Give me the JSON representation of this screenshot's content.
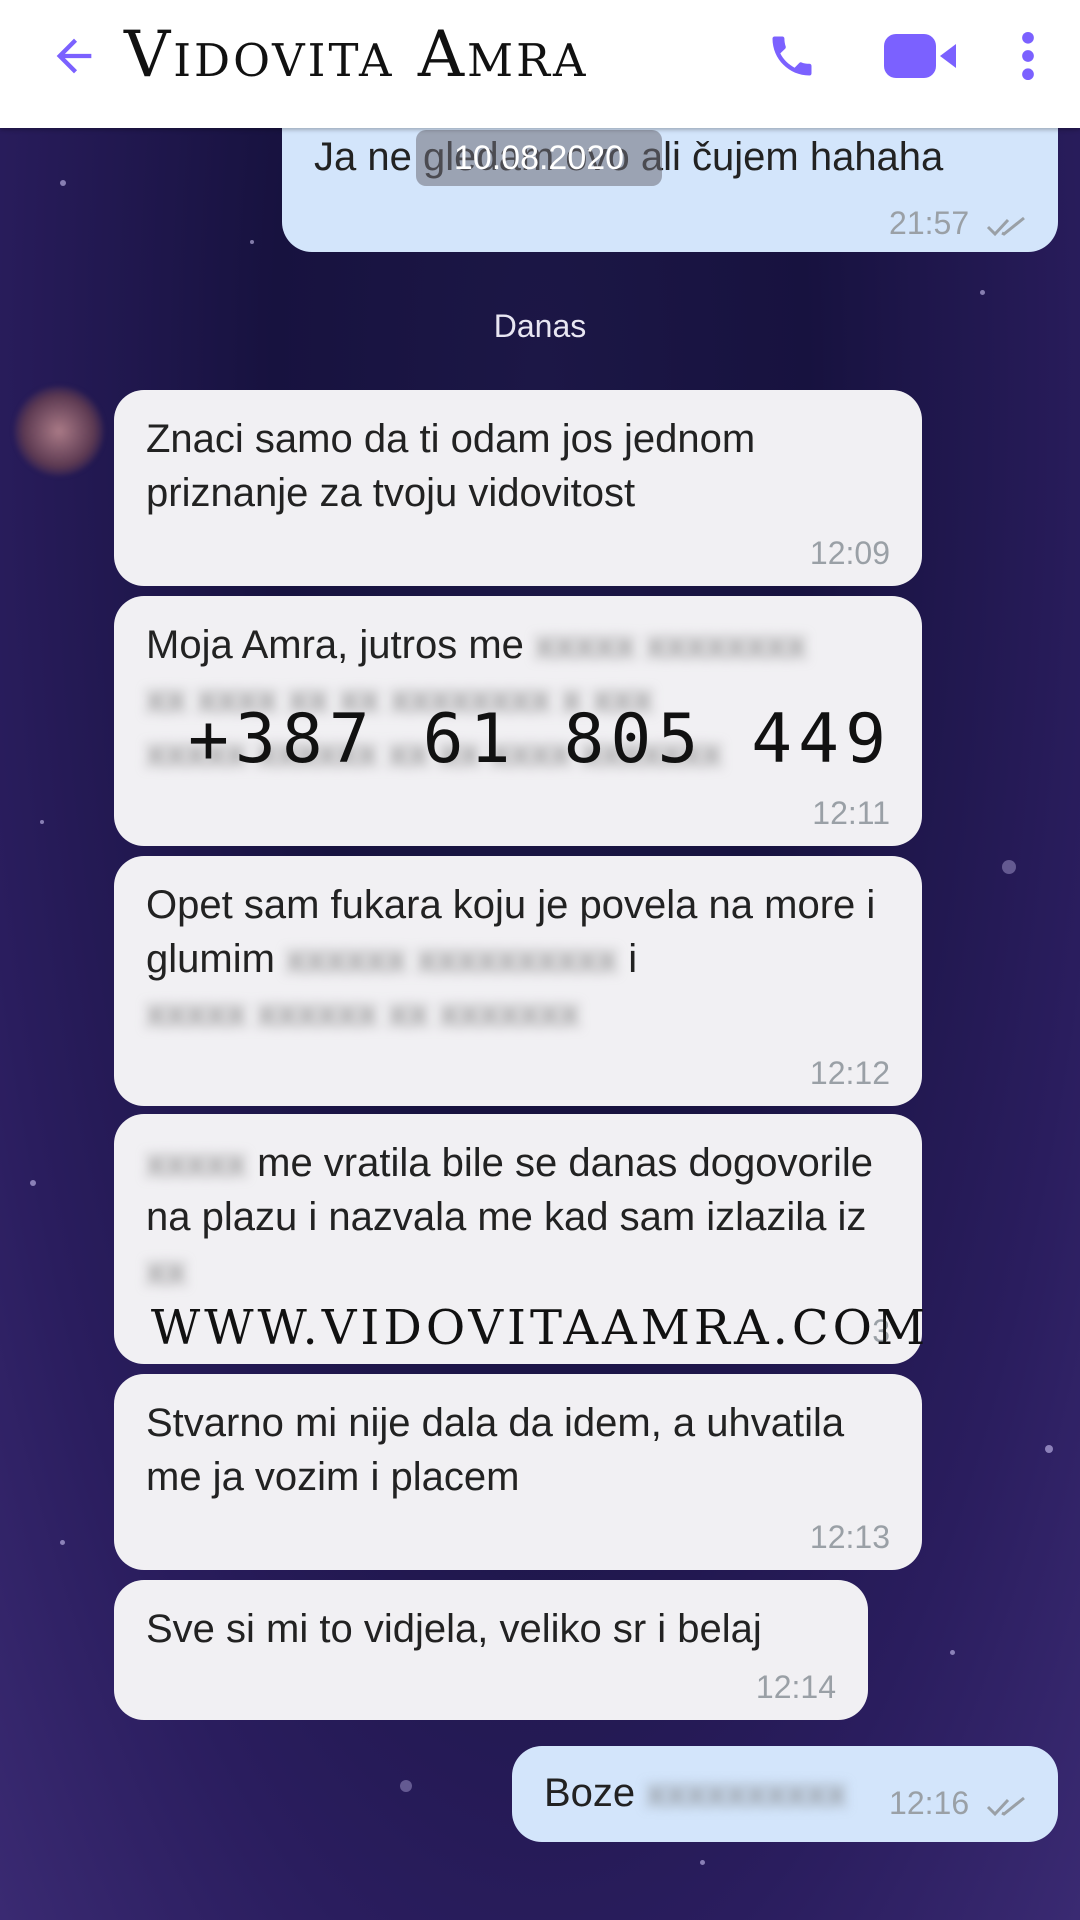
{
  "header": {
    "title": "Vidovita Amra",
    "back_icon": "arrow-left-icon",
    "call_icon": "phone-icon",
    "video_icon": "video-camera-icon",
    "more_icon": "more-vertical-icon",
    "accent": "#7b61ff"
  },
  "chat": {
    "date_pill": "10.08.2020",
    "today_label": "Danas",
    "messages": [
      {
        "dir": "out",
        "text": "Ja ne gledam ovo ali čujem hahaha",
        "time": "21:57",
        "status": "read"
      },
      {
        "dir": "in",
        "text": "Znaci samo da ti odam jos jednom priznanje za tvoju vidovitost",
        "time": "12:09"
      },
      {
        "dir": "in",
        "text": "Moja Amra, jutros me",
        "time": "12:11"
      },
      {
        "dir": "in",
        "text_a": "Opet sam fukara koju je povela na more i glumim",
        "text_b": "i",
        "time": "12:12"
      },
      {
        "dir": "in",
        "text_a": "me vratila bile se danas dogovorile na plazu i nazvala me kad sam izlazila iz",
        "time": "3"
      },
      {
        "dir": "in",
        "text": "Stvarno mi nije dala da idem, a uhvatila me ja vozim i placem",
        "time": "12:13"
      },
      {
        "dir": "in",
        "text": "Sve si mi to vidjela, veliko sr i belaj",
        "time": "12:14"
      },
      {
        "dir": "out",
        "text": "Boze",
        "time": "12:16",
        "status": "read"
      }
    ]
  },
  "watermarks": {
    "phone": "+387 61 805 449",
    "url": "WWW.VIDOVITAAMRA.COM"
  },
  "colors": {
    "incoming_bubble": "#f1f0f3",
    "outgoing_bubble": "#d3e5fb",
    "background": "#17123f"
  }
}
